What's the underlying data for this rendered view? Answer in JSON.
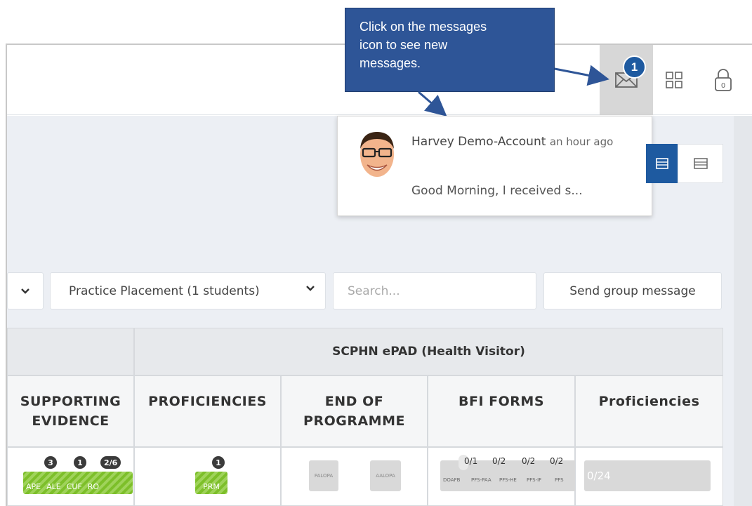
{
  "callout": {
    "text": "Click on the messages\nicon to see new\nmessages."
  },
  "header": {
    "messages_badge": "1",
    "icons": [
      "mail-icon",
      "grid-icon",
      "lock-icon"
    ],
    "lock_count": "0"
  },
  "notification": {
    "sender": "Harvey Demo-Account",
    "time": "an hour ago",
    "preview": "Good Morning, I received s..."
  },
  "filters": {
    "placement": "Practice Placement (1 students)",
    "search_placeholder": "Search...",
    "send_group_message": "Send group message"
  },
  "table": {
    "group_header": "SCPHN ePAD (Health Visitor)",
    "columns": [
      "SUPPORTING EVIDENCE",
      "PROFICIENCIES",
      "END OF PROGRAMME",
      "BFI FORMS",
      "Proficiencies"
    ],
    "supporting_evidence": {
      "chips": [
        "APE",
        "ALE",
        "CUF",
        "RO"
      ],
      "counts": [
        "3",
        "1",
        "2/6"
      ]
    },
    "proficiencies": {
      "chip": "PRM",
      "count": "1"
    },
    "end_of_programme": {
      "boxes": [
        "PALOPA",
        "AALOPA"
      ]
    },
    "bfi_forms": {
      "counts": [
        "0/1",
        "0/2",
        "0/2",
        "0/2"
      ],
      "labels": [
        "DOAFB",
        "PFS-PAA",
        "PFS-HE",
        "PFS-IF",
        "PFS"
      ]
    },
    "proficiencies_progress": "0/24"
  },
  "colors": {
    "brand_blue": "#1e5aa0",
    "callout_blue": "#2e5597",
    "chip_green": "#7dbf2a"
  }
}
